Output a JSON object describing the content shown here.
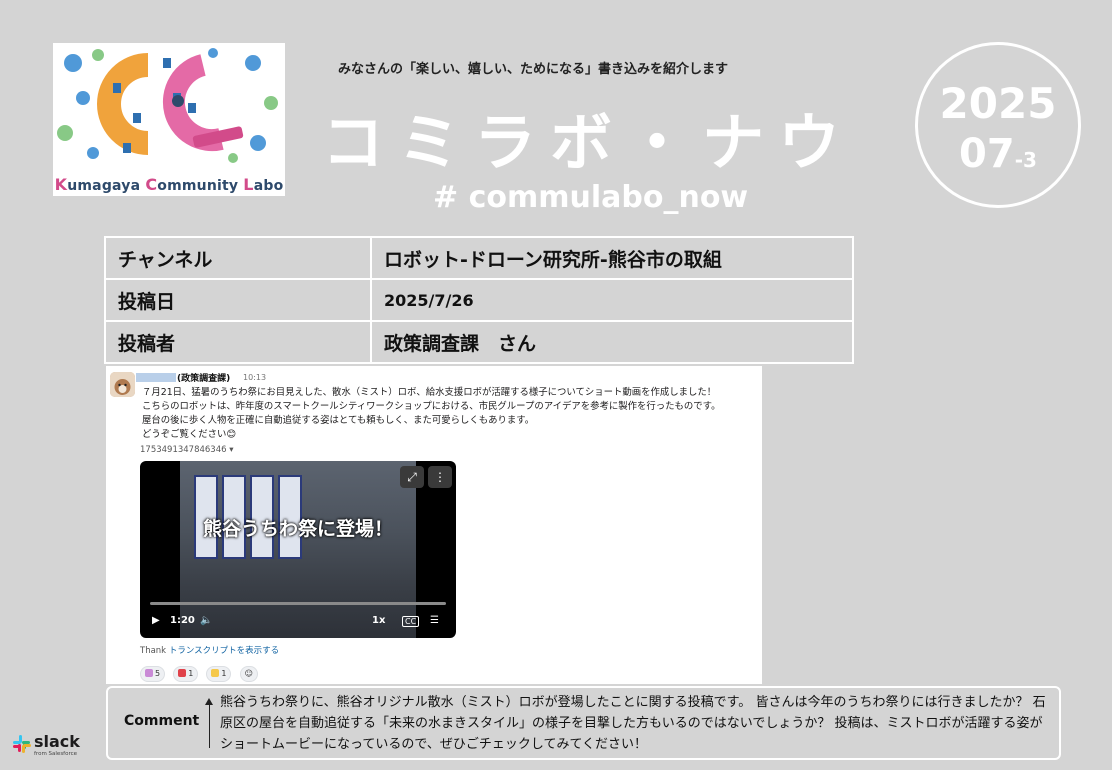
{
  "logo": {
    "caption_parts": [
      "K",
      "umagaya ",
      "C",
      "ommunity ",
      "L",
      "abo"
    ],
    "colors": {
      "blue": "#3e8fd4",
      "orange": "#f0a33c",
      "pink": "#e46aa6",
      "green": "#7cc47a"
    }
  },
  "header": {
    "tagline": "みなさんの「楽しい、嬉しい、ためになる」書き込みを紹介します",
    "title": "コミラボ・ナウ",
    "hashtag": "# commulabo_now"
  },
  "date_badge": {
    "year": "2025",
    "month": "07",
    "issue": "-3"
  },
  "info_table": [
    {
      "label": "チャンネル",
      "value": "ロボット-ドローン研究所-熊谷市の取組"
    },
    {
      "label": "投稿日",
      "value": "2025/7/26"
    },
    {
      "label": "投稿者",
      "value": "政策調査課　さん"
    }
  ],
  "post": {
    "author_suffix": "(政策調査課)",
    "time": "10:13",
    "body_lines": [
      "７月21日、猛暑のうちわ祭にお目見えした、散水（ミスト）ロボ、給水支援ロボが活躍する様子についてショート動画を作成しました！",
      "こちらのロボットは、昨年度のスマートクールシティワークショップにおける、市民グループのアイデアを参考に製作を行ったものです。",
      "屋台の後に歩く人物を正確に自動追従する姿はとても頼もしく、また可愛らしくもあります。",
      "どうぞご覧ください😊"
    ],
    "file_id": "1753491347846346 ▾",
    "video": {
      "overlay_text": "熊谷うちわ祭に登場！",
      "time": "1:20",
      "speed": "1x",
      "progress": 0
    },
    "transcript": {
      "prefix": "Thank",
      "link": "トランスクリプトを表示する"
    },
    "reactions": [
      {
        "count": "5",
        "color": "#c98ad6"
      },
      {
        "count": "1",
        "color": "#e0424a"
      },
      {
        "count": "1",
        "color": "#f5c84a"
      }
    ]
  },
  "comment": {
    "label": "Comment",
    "text": "熊谷うちわ祭りに、熊谷オリジナル散水（ミスト）ロボが登場したことに関する投稿です。 皆さんは今年のうちわ祭りには行きましたか？ 石原区の屋台を自動追従する「未来の水まきスタイル」の様子を目撃した方もいるのではないでしょうか？ 投稿は、ミストロボが活躍する姿がショートムービーになっているので、ぜひごチェックしてみてください！"
  },
  "footer": {
    "brand": "slack",
    "sub": "from Salesforce"
  }
}
